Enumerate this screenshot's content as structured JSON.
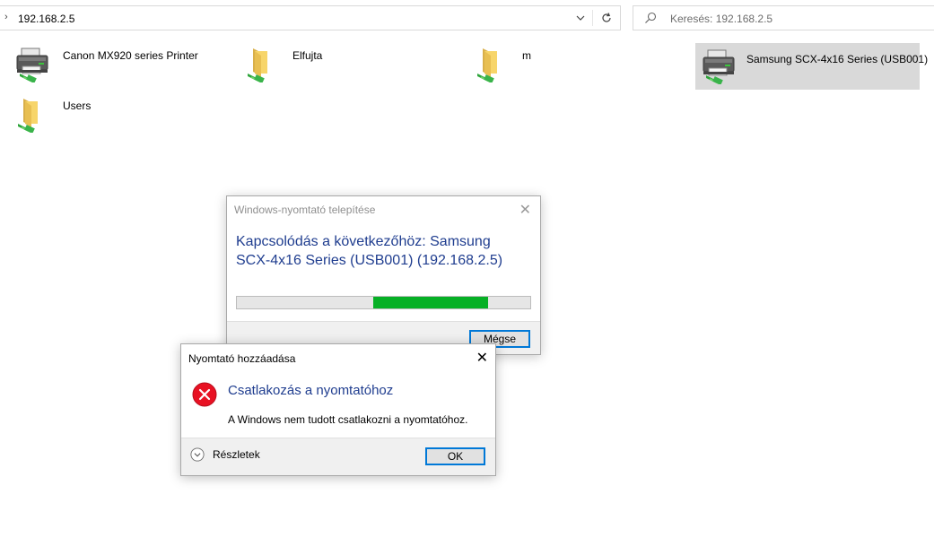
{
  "address_bar": {
    "path": "192.168.2.5"
  },
  "search": {
    "placeholder": "Keresés: 192.168.2.5"
  },
  "items": [
    {
      "label": "Canon MX920 series Printer",
      "icon": "printer-icon"
    },
    {
      "label": "Elfujta",
      "icon": "shared-folder-icon"
    },
    {
      "label": "m",
      "icon": "shared-folder-icon"
    },
    {
      "label": "Samsung SCX-4x16 Series (USB001)",
      "icon": "printer-icon",
      "selected": true
    },
    {
      "label": "Users",
      "icon": "shared-folder-icon"
    }
  ],
  "install_dialog": {
    "title": "Windows-nyomtató telepítése",
    "message": "Kapcsolódás a következőhöz: Samsung SCX-4x16 Series (USB001) (192.168.2.5)",
    "progress": 0.8,
    "cancel_label": "Mégse"
  },
  "error_dialog": {
    "title": "Nyomtató hozzáadása",
    "heading": "Csatlakozás a nyomtatóhoz",
    "body": "A Windows nem tudott csatlakozni a nyomtatóhoz.",
    "details_label": "Részletek",
    "ok_label": "OK"
  },
  "colors": {
    "accent": "#0078d7",
    "heading_blue": "#1f3d8f",
    "progress_green": "#06b025",
    "error_red": "#e81123",
    "selection": "#d9d9d9"
  }
}
